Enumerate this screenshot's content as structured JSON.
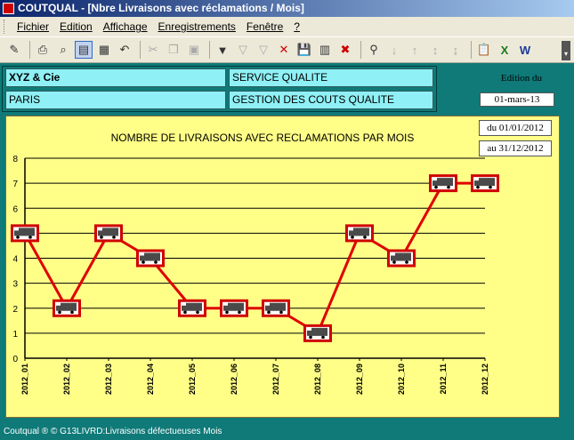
{
  "window": {
    "title": "COUTQUAL - [Nbre Livraisons avec réclamations / Mois]"
  },
  "menu": [
    "Fichier",
    "Edition",
    "Affichage",
    "Enregistrements",
    "Fenêtre",
    "?"
  ],
  "toolbar_icons": [
    "design-view-icon",
    "print-icon",
    "print-preview-icon",
    "form-view-icon",
    "datasheet-view-icon",
    "undo-icon",
    "cut-icon",
    "copy-icon",
    "paste-icon",
    "filter-icon",
    "filter-selection-icon",
    "filter-form-icon",
    "remove-filter-icon",
    "save-icon",
    "save-record-icon",
    "delete-record-icon",
    "find-icon",
    "sort-asc-icon",
    "sort-desc-icon",
    "sort-za-icon",
    "sort-az-icon",
    "report-icon",
    "excel-icon",
    "word-icon"
  ],
  "header": {
    "company": "XYZ & Cie",
    "city": "PARIS",
    "service": "SERVICE QUALITE",
    "subject": "GESTION DES COUTS QUALITE",
    "edition_label": "Edition du",
    "edition_date": "01-mars-13"
  },
  "period": {
    "from": "du 01/01/2012",
    "to": "au 31/12/2012"
  },
  "colors": {
    "background": "#0f7a78",
    "chart_bg": "#ffff88",
    "line": "#e00000",
    "field": "#8ff0f5"
  },
  "chart_data": {
    "type": "line",
    "title": "NOMBRE DE LIVRAISONS AVEC RECLAMATIONS PAR MOIS",
    "categories": [
      "2012_01",
      "2012_02",
      "2012_03",
      "2012_04",
      "2012_05",
      "2012_06",
      "2012_07",
      "2012_08",
      "2012_09",
      "2012_10",
      "2012_11",
      "2012_12"
    ],
    "values": [
      5,
      2,
      5,
      4,
      2,
      2,
      2,
      1,
      5,
      4,
      7,
      7
    ],
    "ylim": [
      0,
      8
    ],
    "yticks": [
      0,
      1,
      2,
      3,
      4,
      5,
      6,
      7,
      8
    ],
    "grid": true,
    "marker": "truck-icon"
  },
  "status": {
    "text": "Coutqual ® ©   G13LIVRD:Livraisons défectueuses Mois"
  }
}
